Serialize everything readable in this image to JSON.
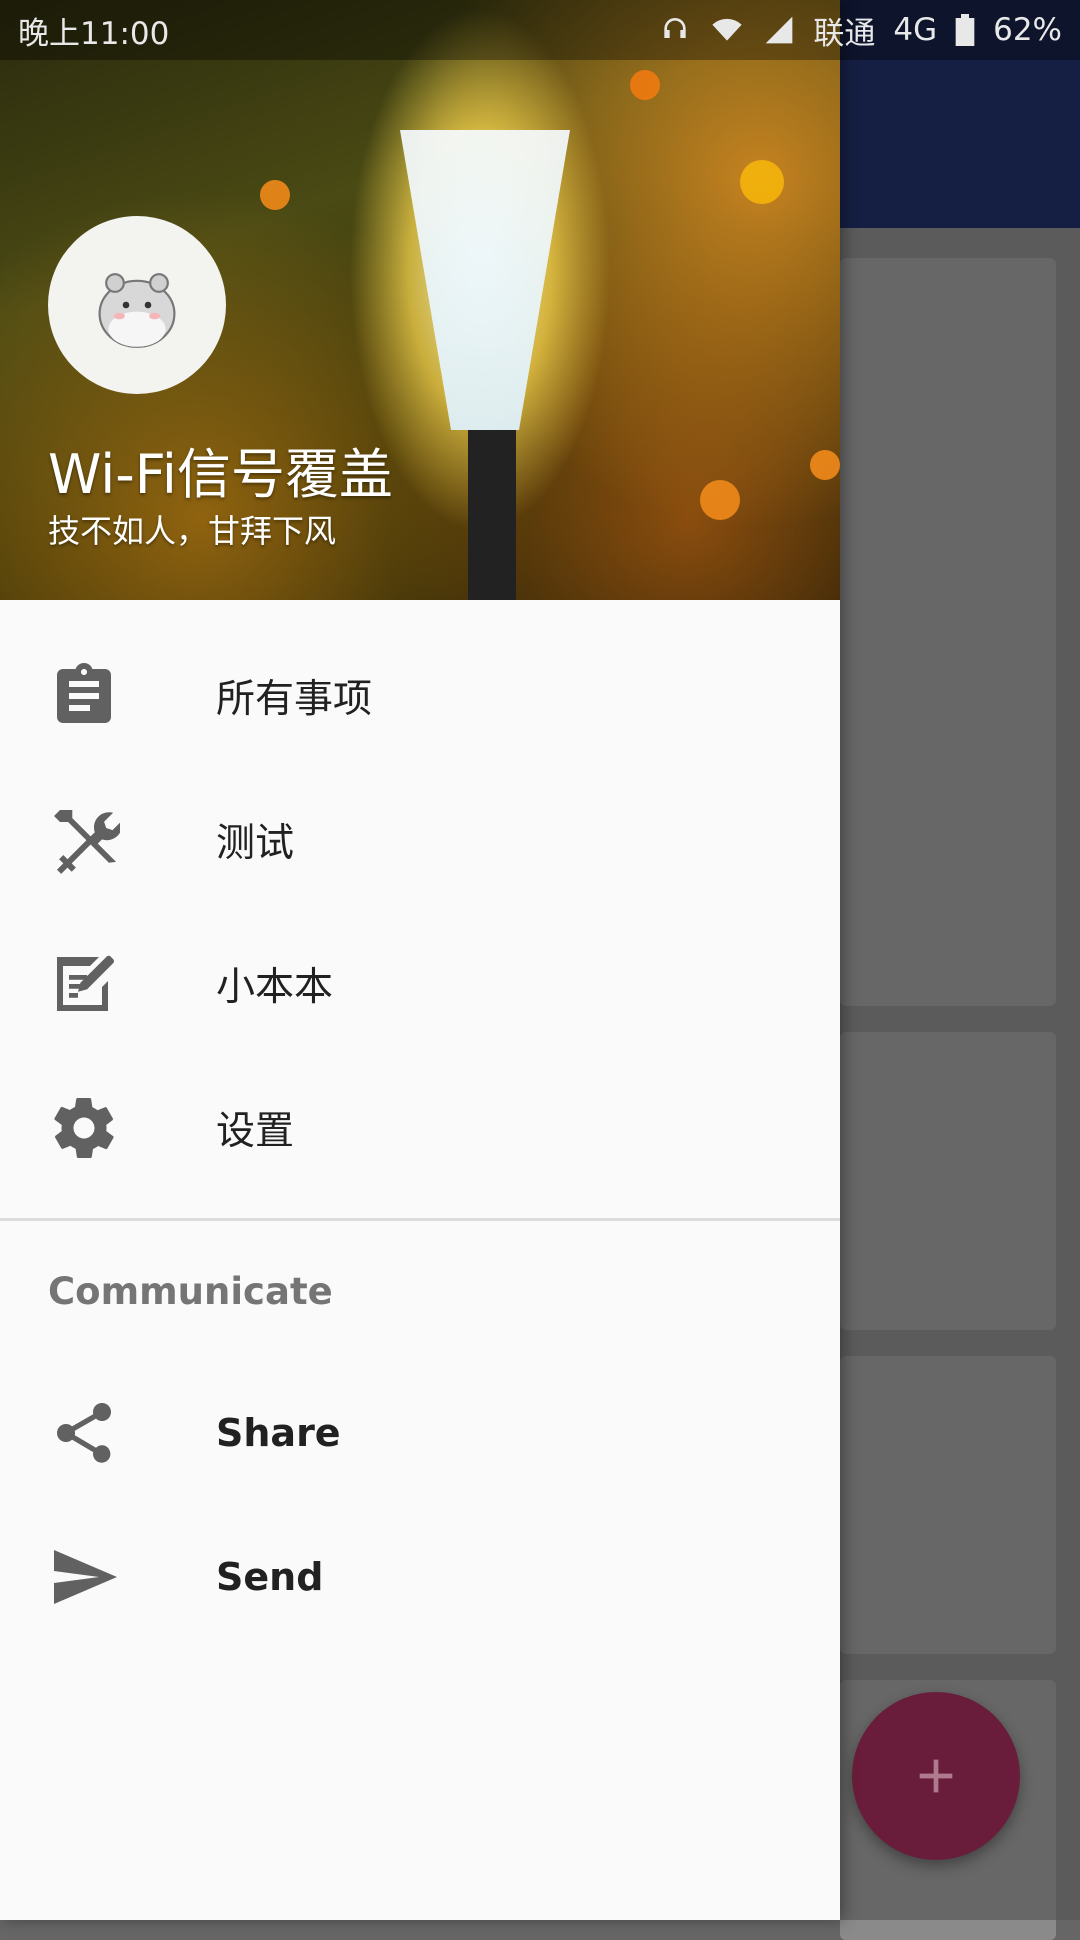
{
  "status_bar": {
    "time": "晚上11:00",
    "carrier": "联通",
    "network": "4G",
    "battery": "62%"
  },
  "drawer": {
    "header": {
      "title": "Wi-Fi信号覆盖",
      "subtitle": "技不如人，甘拜下风"
    },
    "main_items": [
      {
        "label": "所有事项",
        "icon": "clipboard-icon"
      },
      {
        "label": "测试",
        "icon": "tools-icon"
      },
      {
        "label": "小本本",
        "icon": "note-edit-icon"
      },
      {
        "label": "设置",
        "icon": "gear-icon"
      }
    ],
    "section_title": "Communicate",
    "section_items": [
      {
        "label": "Share",
        "icon": "share-icon"
      },
      {
        "label": "Send",
        "icon": "send-icon"
      }
    ]
  },
  "colors": {
    "toolbar": "#1d2a5a",
    "fab": "#6a1d3b",
    "icon": "#616161",
    "drawer_bg": "#fafafa"
  }
}
